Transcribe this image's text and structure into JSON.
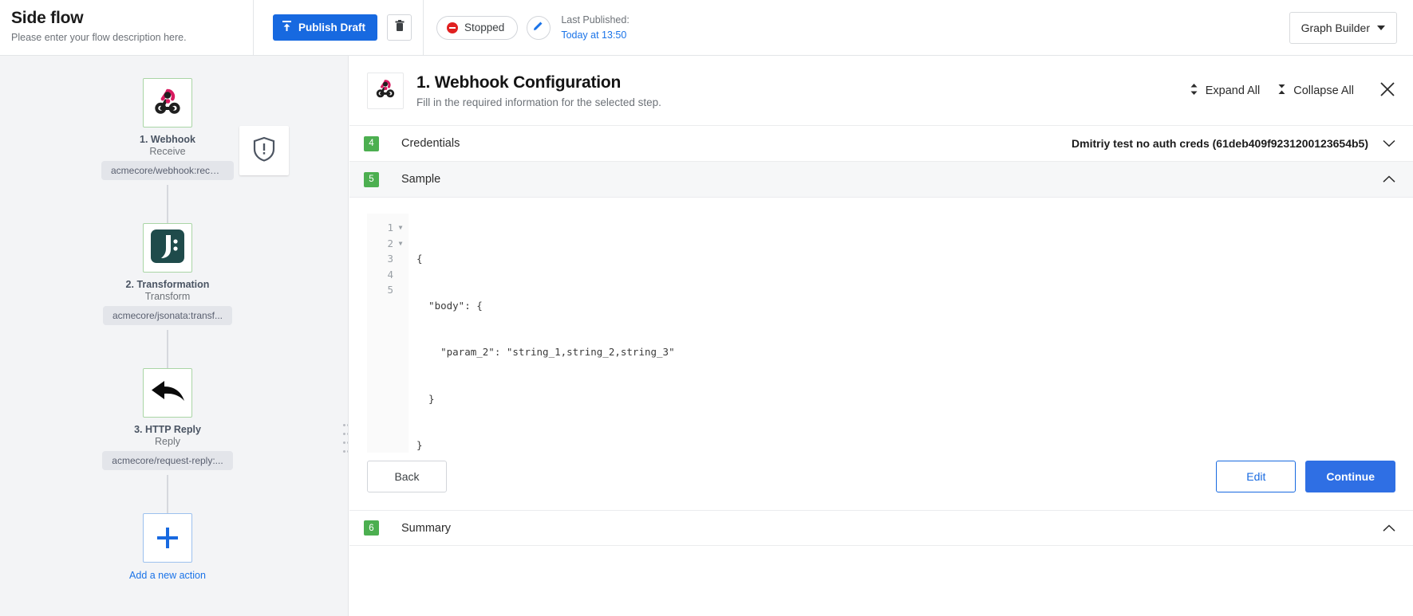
{
  "topbar": {
    "flow_title": "Side flow",
    "flow_description": "Please enter your flow description here.",
    "publish_label": "Publish Draft",
    "publish_icon": "publish-upload-icon",
    "delete_icon": "trash-icon",
    "status_label": "Stopped",
    "status_color": "#e02020",
    "edit_icon": "pencil-icon",
    "last_published_label": "Last Published:",
    "last_published_value": "Today at 13:50",
    "graph_builder_label": "Graph Builder",
    "accent_color": "#1769e0",
    "link_color": "#1a73e8"
  },
  "canvas": {
    "alert_icon": "shield-warning-icon",
    "nodes": [
      {
        "icon": "webhook-icon",
        "title": "1. Webhook",
        "subtitle": "Receive",
        "chip": "acmecore/webhook:recei..."
      },
      {
        "icon": "jsonata-icon",
        "title": "2. Transformation",
        "subtitle": "Transform",
        "chip": "acmecore/jsonata:transf..."
      },
      {
        "icon": "http-reply-arrow-icon",
        "title": "3. HTTP Reply",
        "subtitle": "Reply",
        "chip": "acmecore/request-reply:..."
      }
    ],
    "add_action": {
      "icon": "plus-icon",
      "label": "Add a new action"
    }
  },
  "panel": {
    "header": {
      "icon": "webhook-icon",
      "title": "1. Webhook Configuration",
      "subtitle": "Fill in the required information for the selected step.",
      "expand_all_label": "Expand All",
      "expand_all_icon": "expand-vertical-icon",
      "collapse_all_label": "Collapse All",
      "collapse_all_icon": "collapse-vertical-icon",
      "close_icon": "close-icon"
    },
    "sections": [
      {
        "number": "4",
        "label": "Credentials",
        "value": "Dmitriy test no auth creds (61deb409f9231200123654b5)",
        "chevron": "chevron-down-icon"
      },
      {
        "number": "5",
        "label": "Sample",
        "value": "",
        "chevron": "chevron-up-icon"
      },
      {
        "number": "6",
        "label": "Summary",
        "value": "",
        "chevron": "chevron-up-icon"
      }
    ],
    "sample": {
      "lines": [
        {
          "number": "1",
          "foldable": true,
          "text": "{"
        },
        {
          "number": "2",
          "foldable": true,
          "text": "  \"body\": {"
        },
        {
          "number": "3",
          "foldable": false,
          "text": "    \"param_2\": \"string_1,string_2,string_3\""
        },
        {
          "number": "4",
          "foldable": false,
          "text": "  }"
        },
        {
          "number": "5",
          "foldable": false,
          "text": "}"
        }
      ],
      "back_label": "Back",
      "edit_label": "Edit",
      "continue_label": "Continue"
    }
  }
}
